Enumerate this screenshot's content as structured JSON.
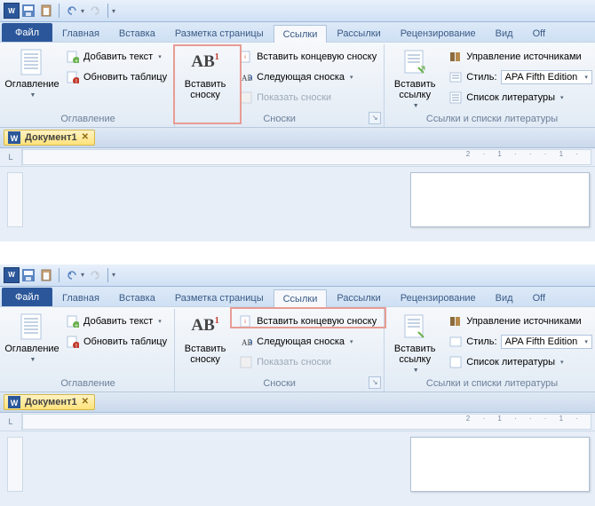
{
  "app": {
    "icon_label": "W"
  },
  "tabs": {
    "file": "Файл",
    "home": "Главная",
    "insert": "Вставка",
    "layout": "Разметка страницы",
    "references": "Ссылки",
    "mailings": "Рассылки",
    "review": "Рецензирование",
    "view": "Вид",
    "office": "Off"
  },
  "ribbon": {
    "toc": {
      "big": "Оглавление",
      "add_text": "Добавить текст",
      "update_table": "Обновить таблицу",
      "group_label": "Оглавление"
    },
    "footnotes": {
      "big_line1": "Вставить",
      "big_line2": "сноску",
      "insert_endnote": "Вставить концевую сноску",
      "next_footnote": "Следующая сноска",
      "show_notes": "Показать сноски",
      "group_label": "Сноски"
    },
    "citations": {
      "big_line1": "Вставить",
      "big_line2": "ссылку",
      "manage_sources": "Управление источниками",
      "style_label": "Стиль:",
      "style_value": "APA Fifth Edition",
      "bibliography": "Список литературы",
      "group_label": "Ссылки и списки литературы"
    }
  },
  "document": {
    "name": "Документ1"
  },
  "ruler": {
    "ticks": "2 · 1 · · · 1 ·"
  }
}
